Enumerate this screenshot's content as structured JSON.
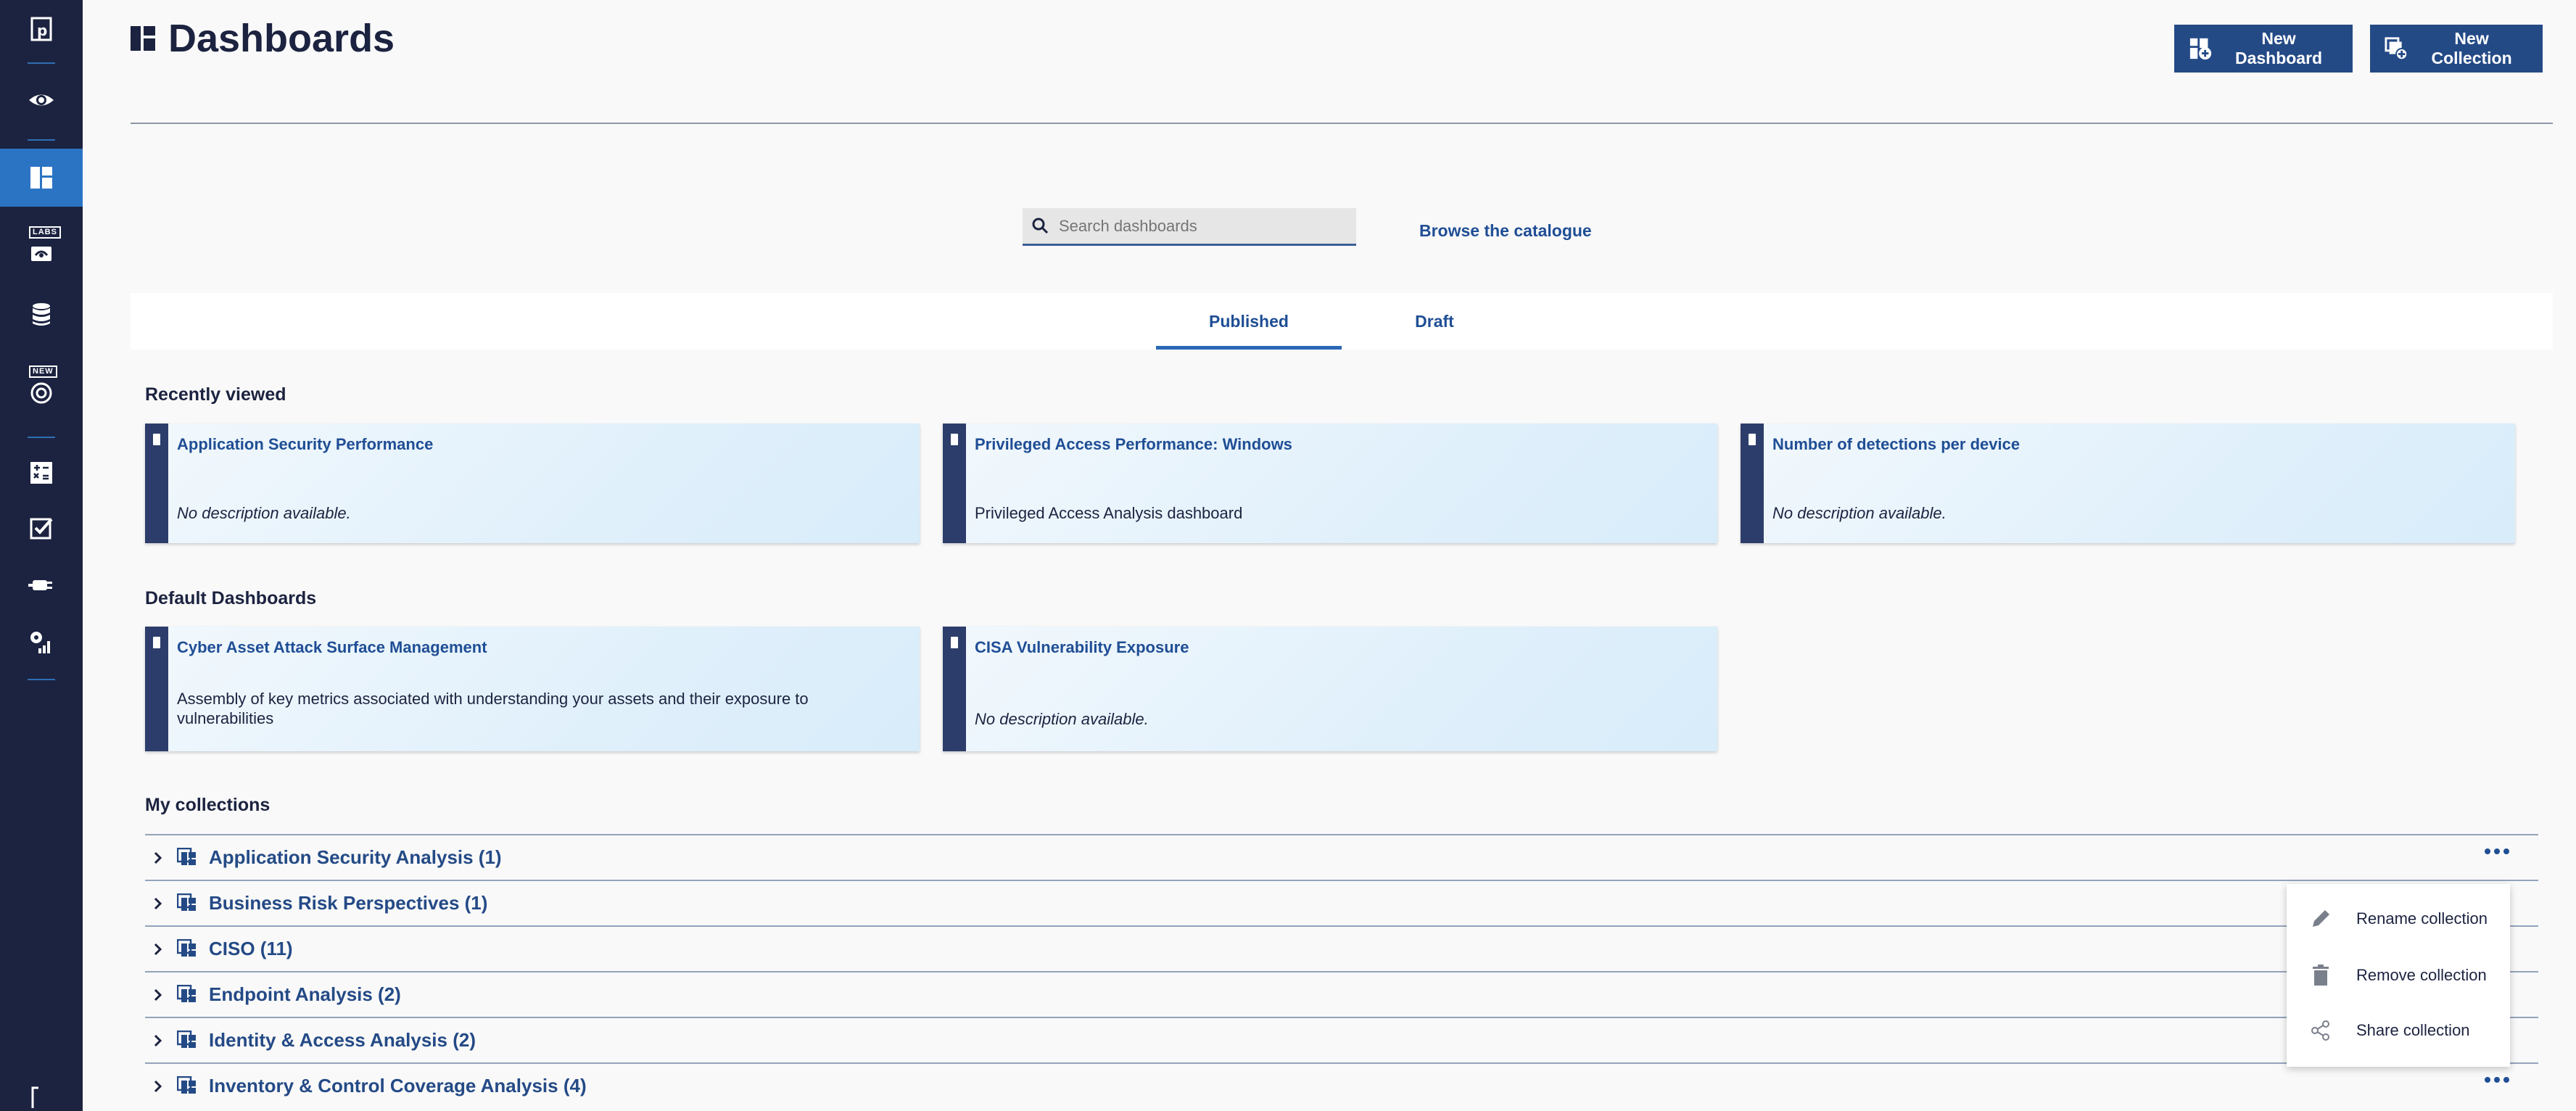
{
  "sidebar": {
    "labs_badge": "LABS",
    "new_badge": "NEW"
  },
  "header": {
    "title": "Dashboards",
    "new_dashboard": "New Dashboard",
    "new_collection": "New Collection"
  },
  "search": {
    "placeholder": "Search dashboards",
    "browse_link": "Browse the catalogue"
  },
  "tabs": [
    {
      "label": "Published",
      "active": true
    },
    {
      "label": "Draft",
      "active": false
    }
  ],
  "recently_viewed": {
    "title": "Recently viewed",
    "cards": [
      {
        "title": "Application Security Performance",
        "description": "No description available."
      },
      {
        "title": "Privileged Access Performance: Windows",
        "description": "Privileged Access Analysis dashboard"
      },
      {
        "title": "Number of detections per device",
        "description": "No description available."
      }
    ]
  },
  "default_dashboards": {
    "title": "Default Dashboards",
    "cards": [
      {
        "title": "Cyber Asset Attack Surface Management",
        "description": "Assembly of key metrics associated with understanding your assets and their exposure to vulnerabilities"
      },
      {
        "title": "CISA Vulnerability Exposure",
        "description": "No description available."
      }
    ]
  },
  "collections": {
    "title": "My collections",
    "items": [
      {
        "label": "Application Security Analysis (1)"
      },
      {
        "label": "Business Risk Perspectives (1)"
      },
      {
        "label": "CISO (11)"
      },
      {
        "label": "Endpoint Analysis (2)"
      },
      {
        "label": "Identity & Access Analysis (2)"
      },
      {
        "label": "Inventory & Control Coverage Analysis (4)"
      }
    ]
  },
  "context_menu": {
    "items": [
      {
        "label": "Rename collection",
        "icon": "pencil-icon"
      },
      {
        "label": "Remove collection",
        "icon": "trash-icon"
      },
      {
        "label": "Share collection",
        "icon": "share-icon"
      }
    ]
  },
  "colors": {
    "sidebar": "#1c2340",
    "accent": "#244a86",
    "active_nav": "#2b74c4",
    "link": "#1f4e95"
  }
}
